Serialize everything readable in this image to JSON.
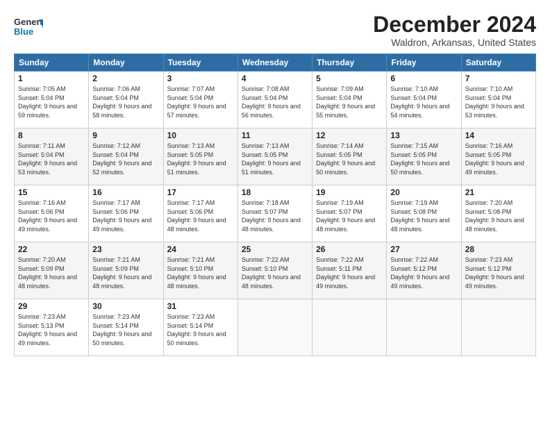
{
  "header": {
    "logo_line1": "General",
    "logo_line2": "Blue",
    "month_title": "December 2024",
    "location": "Waldron, Arkansas, United States"
  },
  "columns": [
    "Sunday",
    "Monday",
    "Tuesday",
    "Wednesday",
    "Thursday",
    "Friday",
    "Saturday"
  ],
  "weeks": [
    [
      {
        "day": "1",
        "sunrise": "7:05 AM",
        "sunset": "5:04 PM",
        "daylight": "9 hours and 59 minutes."
      },
      {
        "day": "2",
        "sunrise": "7:06 AM",
        "sunset": "5:04 PM",
        "daylight": "9 hours and 58 minutes."
      },
      {
        "day": "3",
        "sunrise": "7:07 AM",
        "sunset": "5:04 PM",
        "daylight": "9 hours and 57 minutes."
      },
      {
        "day": "4",
        "sunrise": "7:08 AM",
        "sunset": "5:04 PM",
        "daylight": "9 hours and 56 minutes."
      },
      {
        "day": "5",
        "sunrise": "7:09 AM",
        "sunset": "5:04 PM",
        "daylight": "9 hours and 55 minutes."
      },
      {
        "day": "6",
        "sunrise": "7:10 AM",
        "sunset": "5:04 PM",
        "daylight": "9 hours and 54 minutes."
      },
      {
        "day": "7",
        "sunrise": "7:10 AM",
        "sunset": "5:04 PM",
        "daylight": "9 hours and 53 minutes."
      }
    ],
    [
      {
        "day": "8",
        "sunrise": "7:11 AM",
        "sunset": "5:04 PM",
        "daylight": "9 hours and 53 minutes."
      },
      {
        "day": "9",
        "sunrise": "7:12 AM",
        "sunset": "5:04 PM",
        "daylight": "9 hours and 52 minutes."
      },
      {
        "day": "10",
        "sunrise": "7:13 AM",
        "sunset": "5:05 PM",
        "daylight": "9 hours and 51 minutes."
      },
      {
        "day": "11",
        "sunrise": "7:13 AM",
        "sunset": "5:05 PM",
        "daylight": "9 hours and 51 minutes."
      },
      {
        "day": "12",
        "sunrise": "7:14 AM",
        "sunset": "5:05 PM",
        "daylight": "9 hours and 50 minutes."
      },
      {
        "day": "13",
        "sunrise": "7:15 AM",
        "sunset": "5:05 PM",
        "daylight": "9 hours and 50 minutes."
      },
      {
        "day": "14",
        "sunrise": "7:16 AM",
        "sunset": "5:05 PM",
        "daylight": "9 hours and 49 minutes."
      }
    ],
    [
      {
        "day": "15",
        "sunrise": "7:16 AM",
        "sunset": "5:06 PM",
        "daylight": "9 hours and 49 minutes."
      },
      {
        "day": "16",
        "sunrise": "7:17 AM",
        "sunset": "5:06 PM",
        "daylight": "9 hours and 49 minutes."
      },
      {
        "day": "17",
        "sunrise": "7:17 AM",
        "sunset": "5:06 PM",
        "daylight": "9 hours and 48 minutes."
      },
      {
        "day": "18",
        "sunrise": "7:18 AM",
        "sunset": "5:07 PM",
        "daylight": "9 hours and 48 minutes."
      },
      {
        "day": "19",
        "sunrise": "7:19 AM",
        "sunset": "5:07 PM",
        "daylight": "9 hours and 48 minutes."
      },
      {
        "day": "20",
        "sunrise": "7:19 AM",
        "sunset": "5:08 PM",
        "daylight": "9 hours and 48 minutes."
      },
      {
        "day": "21",
        "sunrise": "7:20 AM",
        "sunset": "5:08 PM",
        "daylight": "9 hours and 48 minutes."
      }
    ],
    [
      {
        "day": "22",
        "sunrise": "7:20 AM",
        "sunset": "5:09 PM",
        "daylight": "9 hours and 48 minutes."
      },
      {
        "day": "23",
        "sunrise": "7:21 AM",
        "sunset": "5:09 PM",
        "daylight": "9 hours and 48 minutes."
      },
      {
        "day": "24",
        "sunrise": "7:21 AM",
        "sunset": "5:10 PM",
        "daylight": "9 hours and 48 minutes."
      },
      {
        "day": "25",
        "sunrise": "7:22 AM",
        "sunset": "5:10 PM",
        "daylight": "9 hours and 48 minutes."
      },
      {
        "day": "26",
        "sunrise": "7:22 AM",
        "sunset": "5:11 PM",
        "daylight": "9 hours and 49 minutes."
      },
      {
        "day": "27",
        "sunrise": "7:22 AM",
        "sunset": "5:12 PM",
        "daylight": "9 hours and 49 minutes."
      },
      {
        "day": "28",
        "sunrise": "7:23 AM",
        "sunset": "5:12 PM",
        "daylight": "9 hours and 49 minutes."
      }
    ],
    [
      {
        "day": "29",
        "sunrise": "7:23 AM",
        "sunset": "5:13 PM",
        "daylight": "9 hours and 49 minutes."
      },
      {
        "day": "30",
        "sunrise": "7:23 AM",
        "sunset": "5:14 PM",
        "daylight": "9 hours and 50 minutes."
      },
      {
        "day": "31",
        "sunrise": "7:23 AM",
        "sunset": "5:14 PM",
        "daylight": "9 hours and 50 minutes."
      },
      null,
      null,
      null,
      null
    ]
  ]
}
